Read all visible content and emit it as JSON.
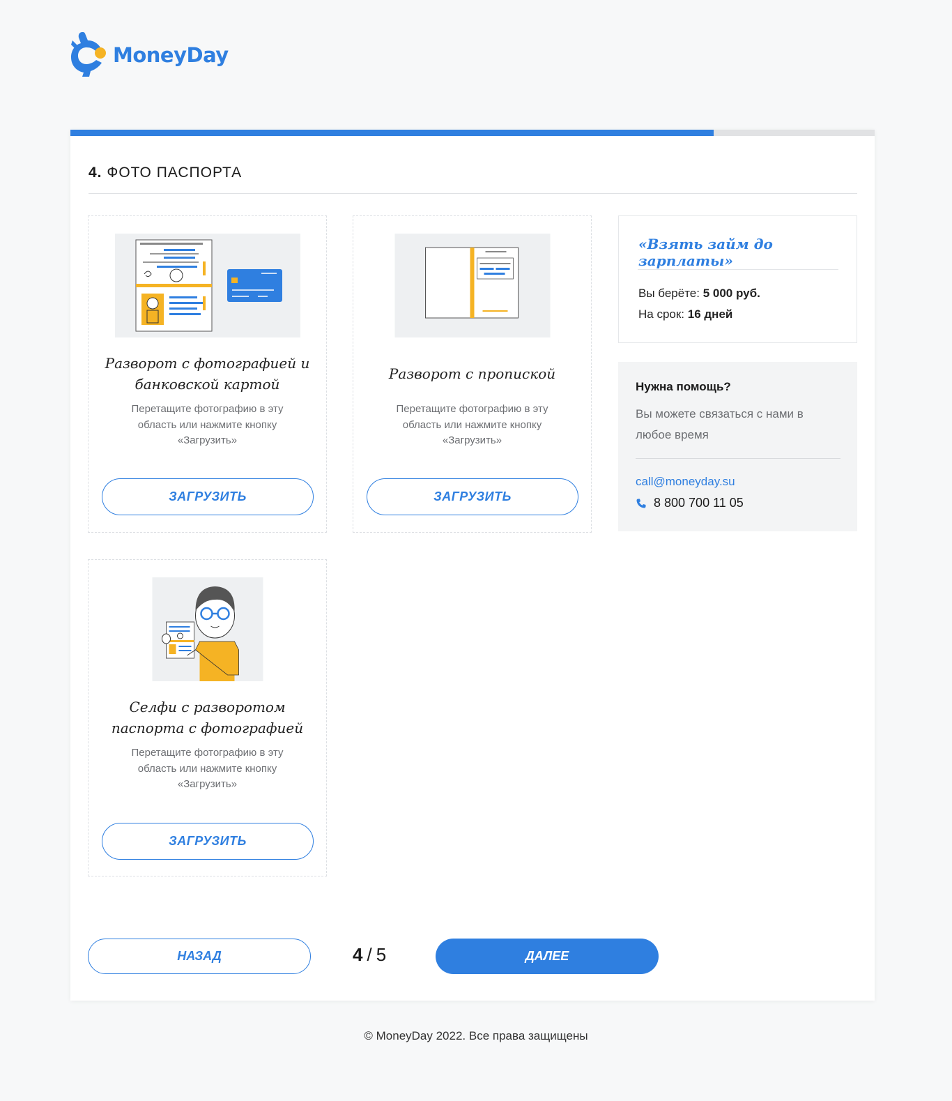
{
  "brand": {
    "name": "MoneyDay",
    "accent": "#2f7fe0",
    "accent_secondary": "#f5b324"
  },
  "progress": {
    "fraction": 0.8
  },
  "step": {
    "number": "4.",
    "title": "ФОТО ПАСПОРТА"
  },
  "upload_cards": [
    {
      "title": "Разворот с фотографией и банковской картой",
      "hint": "Перетащите фотографию в эту область или нажмите кнопку «Загрузить»",
      "button": "ЗАГРУЗИТЬ",
      "illustration": "passport-with-bank-card-icon"
    },
    {
      "title": "Разворот с пропиской",
      "hint": "Перетащите фотографию в эту область или нажмите кнопку «Загрузить»",
      "button": "ЗАГРУЗИТЬ",
      "illustration": "passport-registration-page-icon"
    },
    {
      "title": "Селфи с разворотом паспорта с фотографией",
      "hint": "Перетащите фотографию в эту область или нажмите кнопку «Загрузить»",
      "button": "ЗАГРУЗИТЬ",
      "illustration": "selfie-with-passport-icon"
    }
  ],
  "loan": {
    "title": "«Взять займ до зарплаты»",
    "amount_label": "Вы берёте: ",
    "amount_value": "5 000 руб.",
    "term_label": "На срок: ",
    "term_value": "16 дней"
  },
  "help": {
    "title": "Нужна помощь?",
    "text": "Вы можете связаться с нами в любое время",
    "email": "call@moneyday.su",
    "phone": "8 800 700 11 05",
    "phone_icon": "phone-icon"
  },
  "nav": {
    "back": "НАЗАД",
    "next": "ДАЛЕЕ",
    "current": "4",
    "separator": "/",
    "total": "5"
  },
  "footer": {
    "text": "© MoneyDay 2022. Все права защищены"
  }
}
